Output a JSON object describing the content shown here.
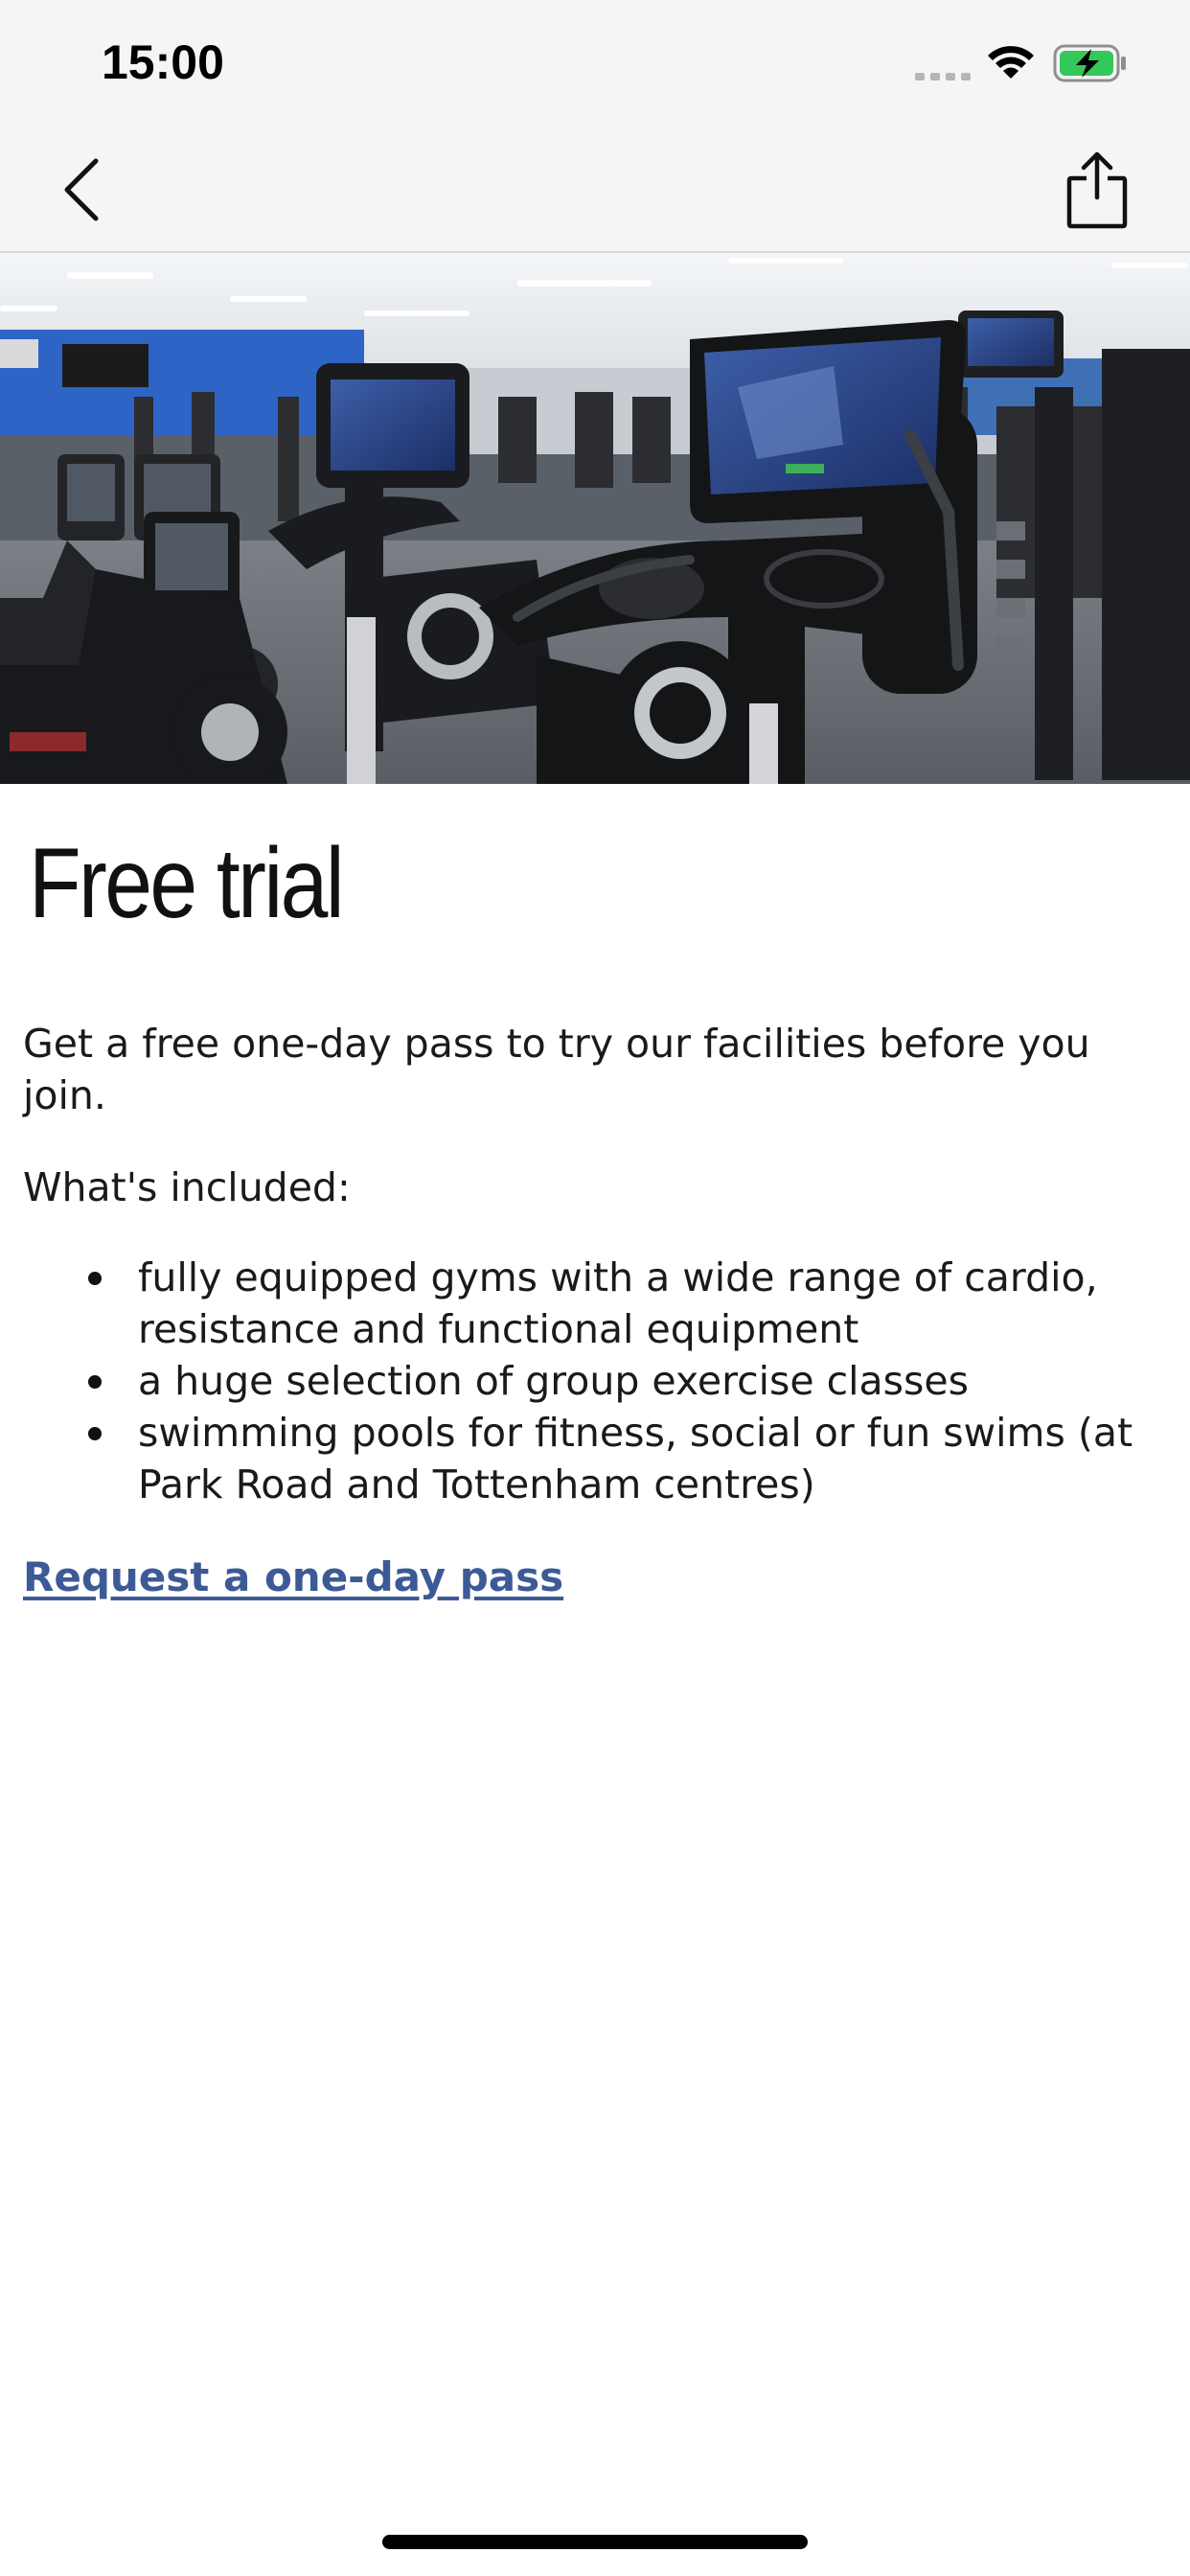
{
  "status_bar": {
    "time": "15:00"
  },
  "nav": {
    "back_icon": "chevron-left-icon",
    "share_icon": "share-icon"
  },
  "hero": {
    "image": "gym-exercise-bikes-photo"
  },
  "content": {
    "title": "Free trial",
    "intro": "Get a free one-day pass to try our facilities before you join.",
    "included_heading": "What's included:",
    "included_items": [
      "fully equipped gyms with a wide range of cardio, resistance and functional equipment",
      "a huge selection of group exercise classes",
      "swimming pools for fitness, social or fun swims (at Park Road and Tottenham centres)"
    ],
    "request_link": "Request a one-day pass"
  },
  "colors": {
    "link": "#3c5a96",
    "bar_background": "#f5f5f5",
    "battery_fill": "#34c759"
  }
}
